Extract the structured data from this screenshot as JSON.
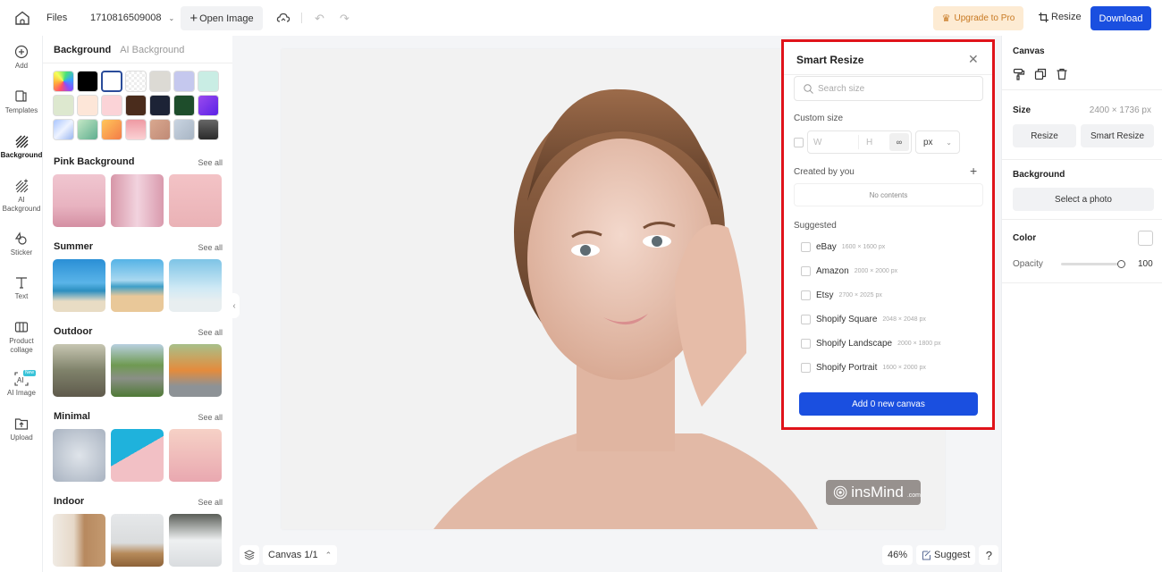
{
  "topbar": {
    "home_icon": "home-icon",
    "files_label": "Files",
    "project_name": "1710816509008",
    "open_image_label": "Open Image",
    "upgrade_label": "Upgrade to Pro",
    "resize_label": "Resize",
    "download_label": "Download",
    "colors": {
      "download": "#1a4fe0",
      "upgrade_bg": "#fdebd3",
      "upgrade_text": "#c87922"
    }
  },
  "leftnav": {
    "items": [
      {
        "label": "Add",
        "icon": "plus-circle-icon"
      },
      {
        "label": "Templates",
        "icon": "templates-icon"
      },
      {
        "label": "Background",
        "icon": "background-icon",
        "active": true
      },
      {
        "label": "AI Background",
        "icon": "ai-background-icon"
      },
      {
        "label": "Sticker",
        "icon": "sticker-icon"
      },
      {
        "label": "Text",
        "icon": "text-icon"
      },
      {
        "label": "Product collage",
        "icon": "collage-icon"
      },
      {
        "label": "AI Image",
        "icon": "ai-image-icon",
        "badge": "New"
      },
      {
        "label": "Upload",
        "icon": "upload-icon"
      }
    ]
  },
  "panel": {
    "tabs": [
      "Background",
      "AI Background"
    ],
    "swatches": [
      "rainbow",
      "#000000",
      "#ffffff",
      "transparent",
      "#dcdad4",
      "#c5c8ee",
      "#c9ede4",
      "#dde8cf",
      "#fde6d8",
      "#fbd3d7",
      "#4a2c1c",
      "#1c2336",
      "#1e4d2b",
      "#7c3ae6",
      "blue-gradient",
      "green-gradient",
      "orange-gradient",
      "pink-gradient",
      "tan-gradient",
      "gray-blue-gradient",
      "dark-gradient"
    ],
    "sections": [
      {
        "title": "Pink Background",
        "see_all": "See all"
      },
      {
        "title": "Summer",
        "see_all": "See all"
      },
      {
        "title": "Outdoor",
        "see_all": "See all"
      },
      {
        "title": "Minimal",
        "see_all": "See all"
      },
      {
        "title": "Indoor",
        "see_all": "See all"
      }
    ]
  },
  "workspace": {
    "watermark": "insMind",
    "watermark_suffix": ".com",
    "canvas_label": "Canvas 1/1",
    "zoom": "46%",
    "suggest_label": "Suggest",
    "help_label": "?"
  },
  "smart_resize": {
    "title": "Smart Resize",
    "search_placeholder": "Search size",
    "custom_size_label": "Custom size",
    "width_placeholder": "W",
    "height_placeholder": "H",
    "unit": "px",
    "created_by_you_label": "Created by you",
    "no_contents": "No contents",
    "suggested_label": "Suggested",
    "suggested": [
      {
        "name": "eBay",
        "dims": "1600 × 1600 px"
      },
      {
        "name": "Amazon",
        "dims": "2000 × 2000 px"
      },
      {
        "name": "Etsy",
        "dims": "2700 × 2025 px"
      },
      {
        "name": "Shopify Square",
        "dims": "2048 × 2048 px"
      },
      {
        "name": "Shopify Landscape",
        "dims": "2000 × 1800 px"
      },
      {
        "name": "Shopify Portrait",
        "dims": "1600 × 2000 px"
      }
    ],
    "add_button": "Add 0 new canvas",
    "highlight_color": "#e0131a"
  },
  "right_panel": {
    "canvas_title": "Canvas",
    "size_label": "Size",
    "size_value": "2400 × 1736 px",
    "resize_btn": "Resize",
    "smart_resize_btn": "Smart Resize",
    "background_label": "Background",
    "select_photo_btn": "Select a photo",
    "color_label": "Color",
    "opacity_label": "Opacity",
    "opacity_value": "100"
  }
}
